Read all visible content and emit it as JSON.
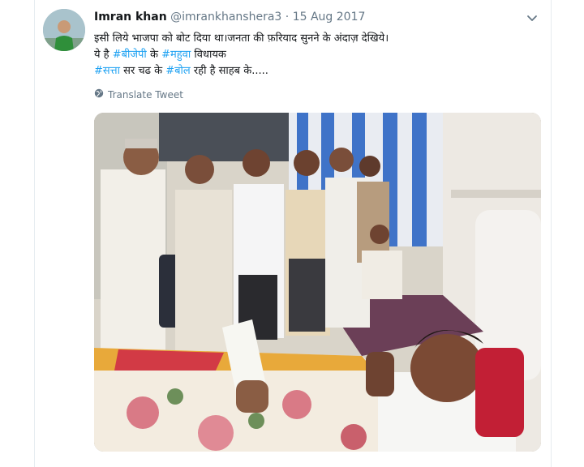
{
  "tweet": {
    "author_name": "Imran khan",
    "handle": "@imrankhanshera3",
    "separator": "·",
    "date": "15 Aug 2017",
    "text_line1": "इसी लिये भाजपा को बोट दिया था।जनता की फ़रियाद सुनने के अंदाज़ देखिये।",
    "text_line2_prefix": "ये है ",
    "hashtag_bjp": "#बीजेपी",
    "text_line2_mid": " के ",
    "hashtag_mahuva": "#महुवा",
    "text_line2_suffix": " विधायक",
    "hashtag_satta": "#सत्ता",
    "text_line3_mid": " सर चढ के ",
    "hashtag_bol": "#बोल",
    "text_line3_suffix": " रही है साहब के.....",
    "translate_label": "Translate Tweet"
  },
  "icons": {
    "more": "chevron-down-icon",
    "translate": "globe-icon"
  },
  "colors": {
    "link": "#1da1f2",
    "secondary": "#657786",
    "text": "#14171a"
  }
}
